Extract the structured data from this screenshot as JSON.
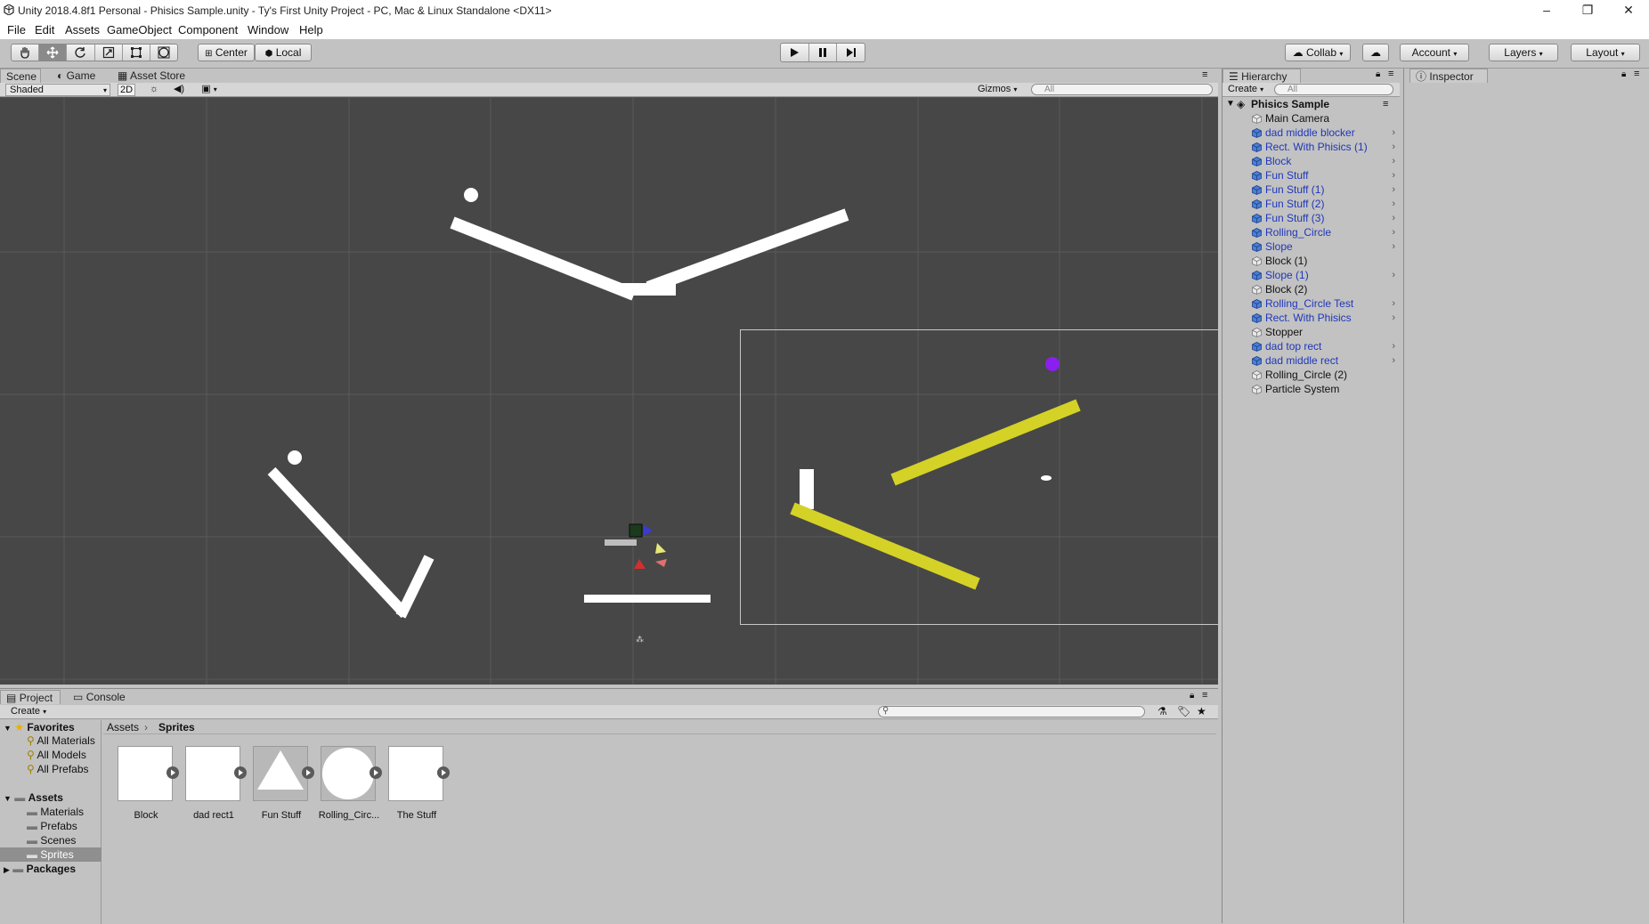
{
  "window": {
    "title": "Unity 2018.4.8f1 Personal - Phisics Sample.unity - Ty's First Unity Project - PC, Mac & Linux Standalone <DX11>",
    "minimize": "–",
    "maximize": "❐",
    "close": "✕"
  },
  "menu": [
    "File",
    "Edit",
    "Assets",
    "GameObject",
    "Component",
    "Window",
    "Help"
  ],
  "toolbar": {
    "pivot": "Center",
    "space": "Local",
    "collab": "Collab",
    "account": "Account",
    "layers": "Layers",
    "layout": "Layout"
  },
  "scene_tabs": {
    "scene": "Scene",
    "game": "Game",
    "asset_store": "Asset Store"
  },
  "scene_toolbar": {
    "shading": "Shaded",
    "mode2d": "2D",
    "gizmos": "Gizmos",
    "search_placeholder": "All"
  },
  "hierarchy": {
    "tab": "Hierarchy",
    "create": "Create",
    "search_placeholder": "All",
    "scene_name": "Phisics Sample",
    "items": [
      {
        "label": "Main Camera",
        "prefab": false,
        "children": false
      },
      {
        "label": "dad middle blocker",
        "prefab": true,
        "children": true
      },
      {
        "label": "Rect. With Phisics (1)",
        "prefab": true,
        "children": true
      },
      {
        "label": "Block",
        "prefab": true,
        "children": true
      },
      {
        "label": "Fun Stuff",
        "prefab": true,
        "children": true
      },
      {
        "label": "Fun Stuff (1)",
        "prefab": true,
        "children": true
      },
      {
        "label": "Fun Stuff (2)",
        "prefab": true,
        "children": true
      },
      {
        "label": "Fun Stuff (3)",
        "prefab": true,
        "children": true
      },
      {
        "label": "Rolling_Circle",
        "prefab": true,
        "children": true
      },
      {
        "label": "Slope",
        "prefab": true,
        "children": true
      },
      {
        "label": "Block (1)",
        "prefab": false,
        "children": false
      },
      {
        "label": "Slope (1)",
        "prefab": true,
        "children": true
      },
      {
        "label": "Block (2)",
        "prefab": false,
        "children": false
      },
      {
        "label": "Rolling_Circle Test",
        "prefab": true,
        "children": true
      },
      {
        "label": "Rect. With Phisics",
        "prefab": true,
        "children": true
      },
      {
        "label": "Stopper",
        "prefab": false,
        "children": false
      },
      {
        "label": "dad top rect",
        "prefab": true,
        "children": true
      },
      {
        "label": "dad middle rect",
        "prefab": true,
        "children": true
      },
      {
        "label": "Rolling_Circle (2)",
        "prefab": false,
        "children": false
      },
      {
        "label": "Particle System",
        "prefab": false,
        "children": false
      }
    ]
  },
  "inspector": {
    "tab": "Inspector"
  },
  "project": {
    "tab": "Project",
    "console_tab": "Console",
    "create": "Create",
    "breadcrumb_root": "Assets",
    "breadcrumb_current": "Sprites",
    "sidebar": {
      "favorites": "Favorites",
      "favorite_items": [
        "All Materials",
        "All Models",
        "All Prefabs"
      ],
      "assets": "Assets",
      "asset_folders": [
        "Materials",
        "Prefabs",
        "Scenes",
        "Sprites"
      ],
      "packages": "Packages"
    },
    "assets": [
      {
        "label": "Block",
        "shape": "square"
      },
      {
        "label": "dad rect1",
        "shape": "square"
      },
      {
        "label": "Fun Stuff",
        "shape": "triangle"
      },
      {
        "label": "Rolling_Circ...",
        "shape": "circle"
      },
      {
        "label": "The Stuff",
        "shape": "square"
      }
    ]
  },
  "colors": {
    "scene_bg": "#474747",
    "prefab_text": "#1f37b8",
    "yellow_bar": "#d4d226",
    "purple_ball": "#8a1ff0",
    "selection": "#3d7bd6"
  }
}
